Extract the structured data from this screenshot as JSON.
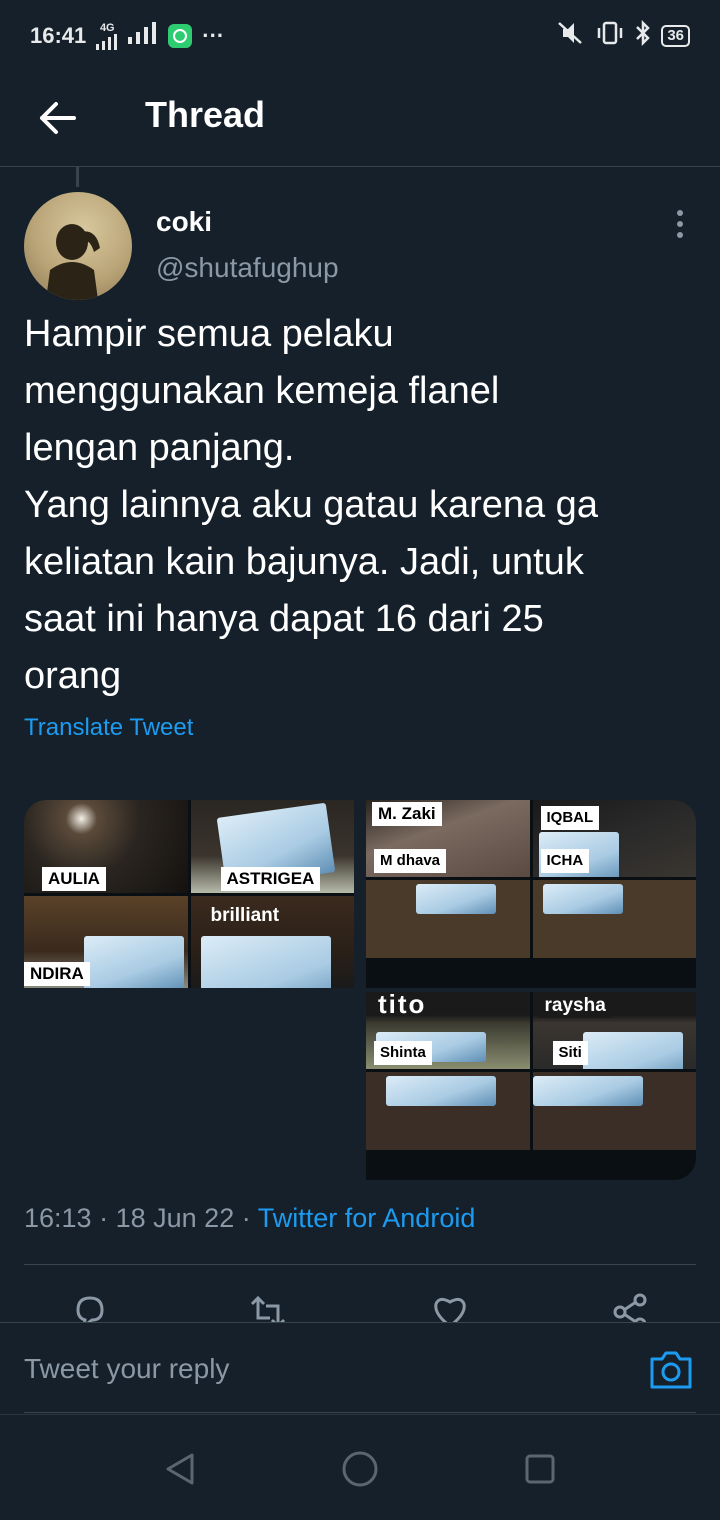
{
  "status_bar": {
    "time": "16:41",
    "network": "4G",
    "ellipsis": "···",
    "battery": "36",
    "icons": [
      "signal-4g-icon",
      "signal-icon",
      "chat-app-icon",
      "mute-icon",
      "vibrate-icon",
      "bluetooth-icon",
      "battery-icon"
    ]
  },
  "header": {
    "title": "Thread",
    "back_icon": "arrow-left-icon"
  },
  "tweet": {
    "display_name": "coki",
    "handle": "@shutafughup",
    "text": "Hampir semua pelaku\nmenggunakan kemeja flanel\nlengan panjang.\nYang lainnya aku gatau karena ga\nkeliatan kain bajunya. Jadi, untuk\nsaat ini hanya dapat 16 dari 25\norang",
    "translate_label": "Translate Tweet",
    "time": "16:13",
    "date": "18 Jun 22",
    "source": "Twitter for Android",
    "separator": "·",
    "media": [
      {
        "labels": [
          "AULIA",
          "ASTRIGEA",
          "NDIRA",
          "brilliant"
        ]
      },
      {
        "labels": [
          "M. Zaki",
          "IQBAL",
          "M dhava",
          "ICHA"
        ]
      },
      {
        "labels": []
      },
      {
        "labels": [
          "tito",
          "raysha",
          "Shinta",
          "Siti"
        ]
      }
    ]
  },
  "actions": {
    "icons": [
      "reply-icon",
      "retweet-icon",
      "like-icon",
      "share-icon"
    ]
  },
  "reply": {
    "placeholder": "Tweet your reply",
    "camera_icon": "camera-icon"
  },
  "nav": {
    "icons": [
      "back-triangle-icon",
      "home-circle-icon",
      "recents-square-icon"
    ]
  },
  "colors": {
    "background": "#15202b",
    "accent": "#1d9bf0",
    "secondary_text": "#8b98a5",
    "divider": "#38444d"
  }
}
